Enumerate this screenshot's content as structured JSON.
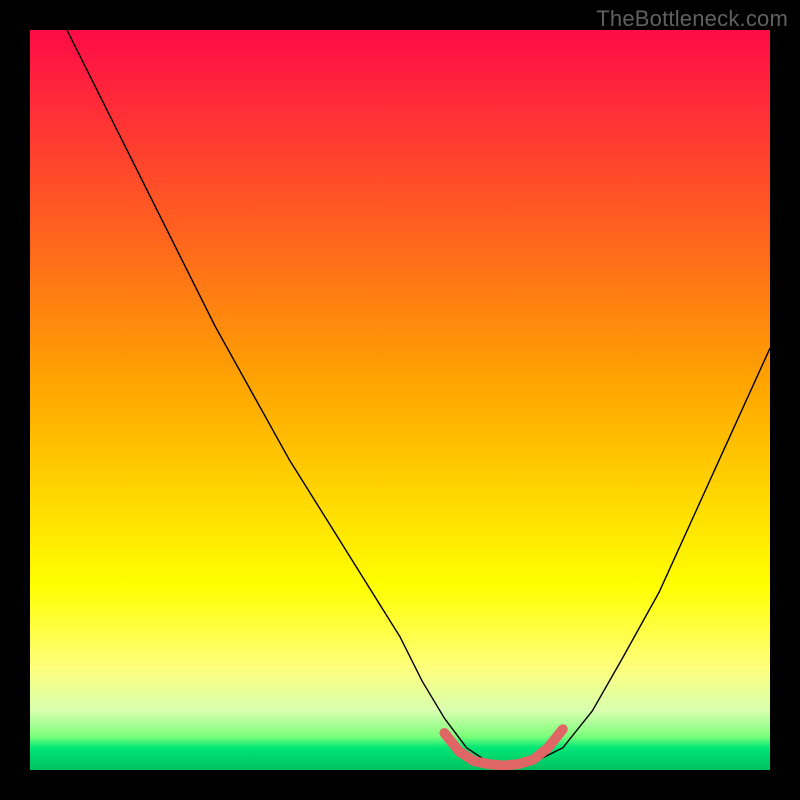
{
  "watermark": "TheBottleneck.com",
  "chart_data": {
    "type": "line",
    "title": "",
    "xlabel": "",
    "ylabel": "",
    "xlim": [
      0,
      100
    ],
    "ylim": [
      0,
      100
    ],
    "background_gradient": {
      "stops": [
        {
          "offset": 0.0,
          "color": "#ff0b47"
        },
        {
          "offset": 0.48,
          "color": "#ffa500"
        },
        {
          "offset": 0.75,
          "color": "#ffff00"
        },
        {
          "offset": 0.86,
          "color": "#ffff7a"
        },
        {
          "offset": 0.92,
          "color": "#d8ffb0"
        },
        {
          "offset": 0.955,
          "color": "#7aff7a"
        },
        {
          "offset": 0.97,
          "color": "#00e676"
        },
        {
          "offset": 1.0,
          "color": "#00c060"
        }
      ]
    },
    "series": [
      {
        "name": "bottleneck-curve",
        "type": "line",
        "color": "#000000",
        "width": 1.4,
        "x": [
          5,
          10,
          15,
          20,
          25,
          30,
          35,
          40,
          45,
          50,
          53,
          56,
          59,
          62,
          65,
          68,
          72,
          76,
          80,
          85,
          90,
          95,
          100
        ],
        "y": [
          100,
          90,
          80,
          70,
          60,
          51,
          42,
          34,
          26,
          18,
          12,
          7,
          3,
          1,
          0.5,
          1,
          3,
          8,
          15,
          24,
          35,
          46,
          57
        ]
      },
      {
        "name": "optimal-range-band",
        "type": "line",
        "color": "#e06666",
        "width": 10,
        "x": [
          56,
          58,
          60,
          62,
          64,
          66,
          68,
          70,
          72
        ],
        "y": [
          5,
          2.5,
          1.2,
          0.8,
          0.6,
          0.8,
          1.4,
          3,
          5.5
        ]
      }
    ],
    "annotations": []
  }
}
